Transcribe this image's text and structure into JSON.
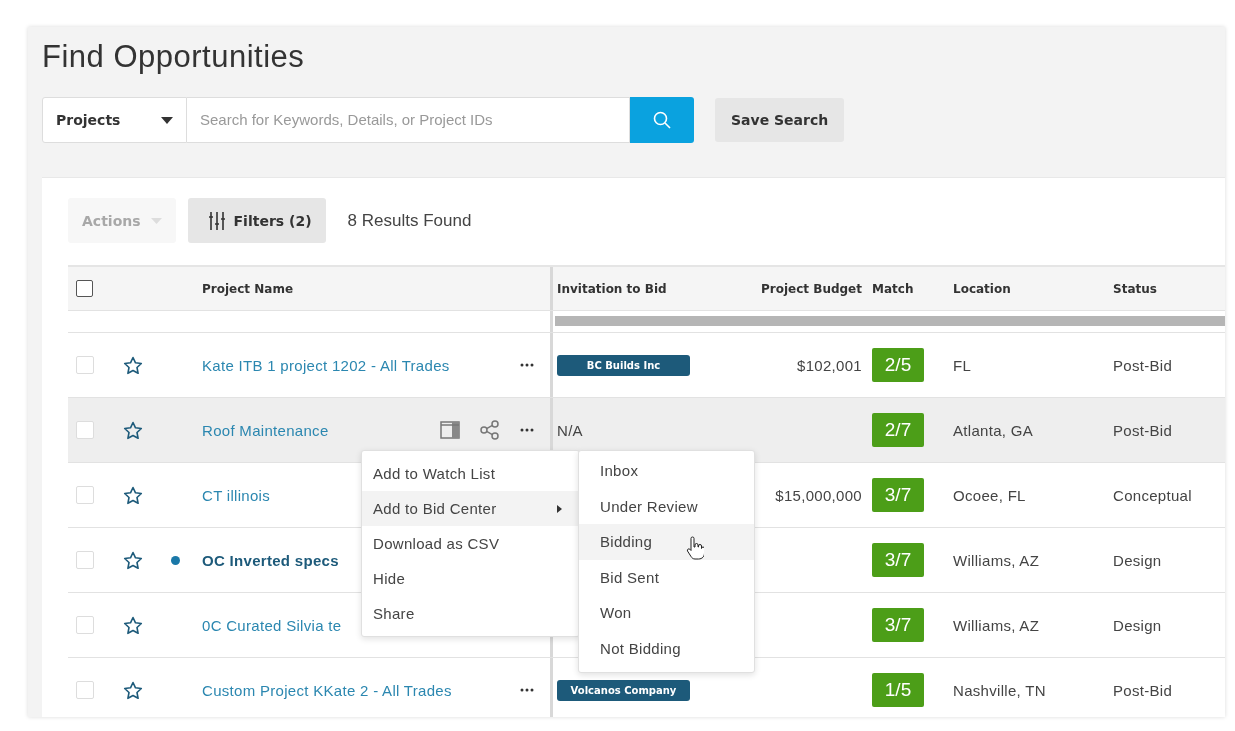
{
  "page": {
    "title": "Find Opportunities"
  },
  "search": {
    "scope": "Projects",
    "placeholder": "Search for Keywords, Details, or Project IDs",
    "save_label": "Save Search"
  },
  "toolbar": {
    "actions": {
      "label": "Actions",
      "disabled": true
    },
    "filters": {
      "label": "Filters (2)"
    },
    "results": "8 Results Found"
  },
  "table": {
    "select_all": {
      "checked": false
    },
    "columns": [
      "Project Name",
      "Invitation to Bid",
      "Project Budget",
      "Match",
      "Location",
      "Status"
    ],
    "rows": [
      {
        "name": "Kate ITB 1 project 1202 - All Trades",
        "unread": false,
        "hovered": false,
        "checked": false,
        "starred": false,
        "more_visible": true,
        "invitation": {
          "kind": "badge",
          "text": "BC Builds Inc"
        },
        "budget": "$102,001",
        "match": "2/5",
        "location": "FL",
        "status": "Post-Bid"
      },
      {
        "name": "Roof Maintenance",
        "unread": false,
        "hovered": true,
        "checked": false,
        "starred": false,
        "more_visible": true,
        "invitation": {
          "kind": "text",
          "text": "N/A"
        },
        "match": "2/7",
        "location": "Atlanta, GA",
        "status": "Post-Bid"
      },
      {
        "name": "CT illinois",
        "unread": false,
        "hovered": false,
        "checked": false,
        "starred": false,
        "budget": "$15,000,000",
        "match": "3/7",
        "location": "Ocoee, FL",
        "status": "Conceptual"
      },
      {
        "name": "OC Inverted specs",
        "unread": true,
        "hovered": false,
        "checked": false,
        "starred": false,
        "match": "3/7",
        "location": "Williams, AZ",
        "status": "Design"
      },
      {
        "name": "0C Curated Silvia te",
        "unread": false,
        "hovered": false,
        "checked": false,
        "starred": false,
        "match": "3/7",
        "location": "Williams, AZ",
        "status": "Design"
      },
      {
        "name": "Custom Project KKate 2 - All Trades",
        "unread": false,
        "hovered": false,
        "checked": false,
        "starred": false,
        "more_visible": true,
        "invitation": {
          "kind": "badge",
          "text": "Volcanos Company"
        },
        "match": "1/5",
        "location": "Nashville, TN",
        "status": "Post-Bid"
      }
    ]
  },
  "context_menu": {
    "items": [
      {
        "label": "Add to Watch List",
        "highlighted": false,
        "submenu": false
      },
      {
        "label": "Add to Bid Center",
        "highlighted": true,
        "submenu": true
      },
      {
        "label": "Download as CSV",
        "highlighted": false,
        "submenu": false
      },
      {
        "label": "Hide",
        "highlighted": false,
        "submenu": false
      },
      {
        "label": "Share",
        "highlighted": false,
        "submenu": false
      }
    ],
    "submenu": [
      {
        "label": "Inbox",
        "highlighted": false
      },
      {
        "label": "Under Review",
        "highlighted": false
      },
      {
        "label": "Bidding",
        "highlighted": true
      },
      {
        "label": "Bid Sent",
        "highlighted": false
      },
      {
        "label": "Won",
        "highlighted": false
      },
      {
        "label": "Not Bidding",
        "highlighted": false
      }
    ]
  }
}
